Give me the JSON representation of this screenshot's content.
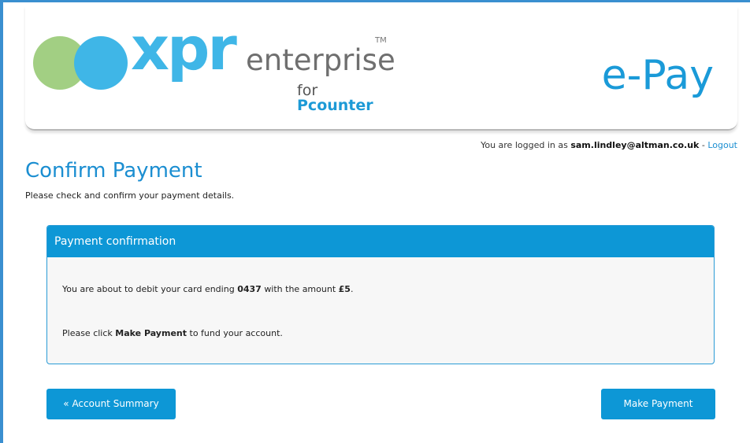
{
  "brand": {
    "logo_main": "xpr",
    "logo_sub": "enterprise",
    "logo_tm": "TM",
    "logo_for": "for",
    "logo_product": "Pcounter",
    "product_title": "e-Pay",
    "colors": {
      "accent": "#0d97d6",
      "logo_blue": "#3fb6e7",
      "logo_green": "#a2cf83",
      "frame": "#3a8fd0"
    }
  },
  "session": {
    "prefix": "You are logged in as",
    "user": "sam.lindley@altman.co.uk",
    "separator": "-",
    "logout_label": "Logout"
  },
  "page": {
    "title": "Confirm Payment",
    "subtitle": "Please check and confirm your payment details."
  },
  "confirmation": {
    "header": "Payment confirmation",
    "debit_text_1": "You are about to debit your card ending",
    "card_last4": "0437",
    "debit_text_2": "with the amount",
    "amount": "£5",
    "debit_end": ".",
    "prompt_1": "Please click",
    "prompt_action": "Make Payment",
    "prompt_2": "to fund your account."
  },
  "actions": {
    "back_label": "« Account Summary",
    "pay_label": "Make Payment"
  }
}
